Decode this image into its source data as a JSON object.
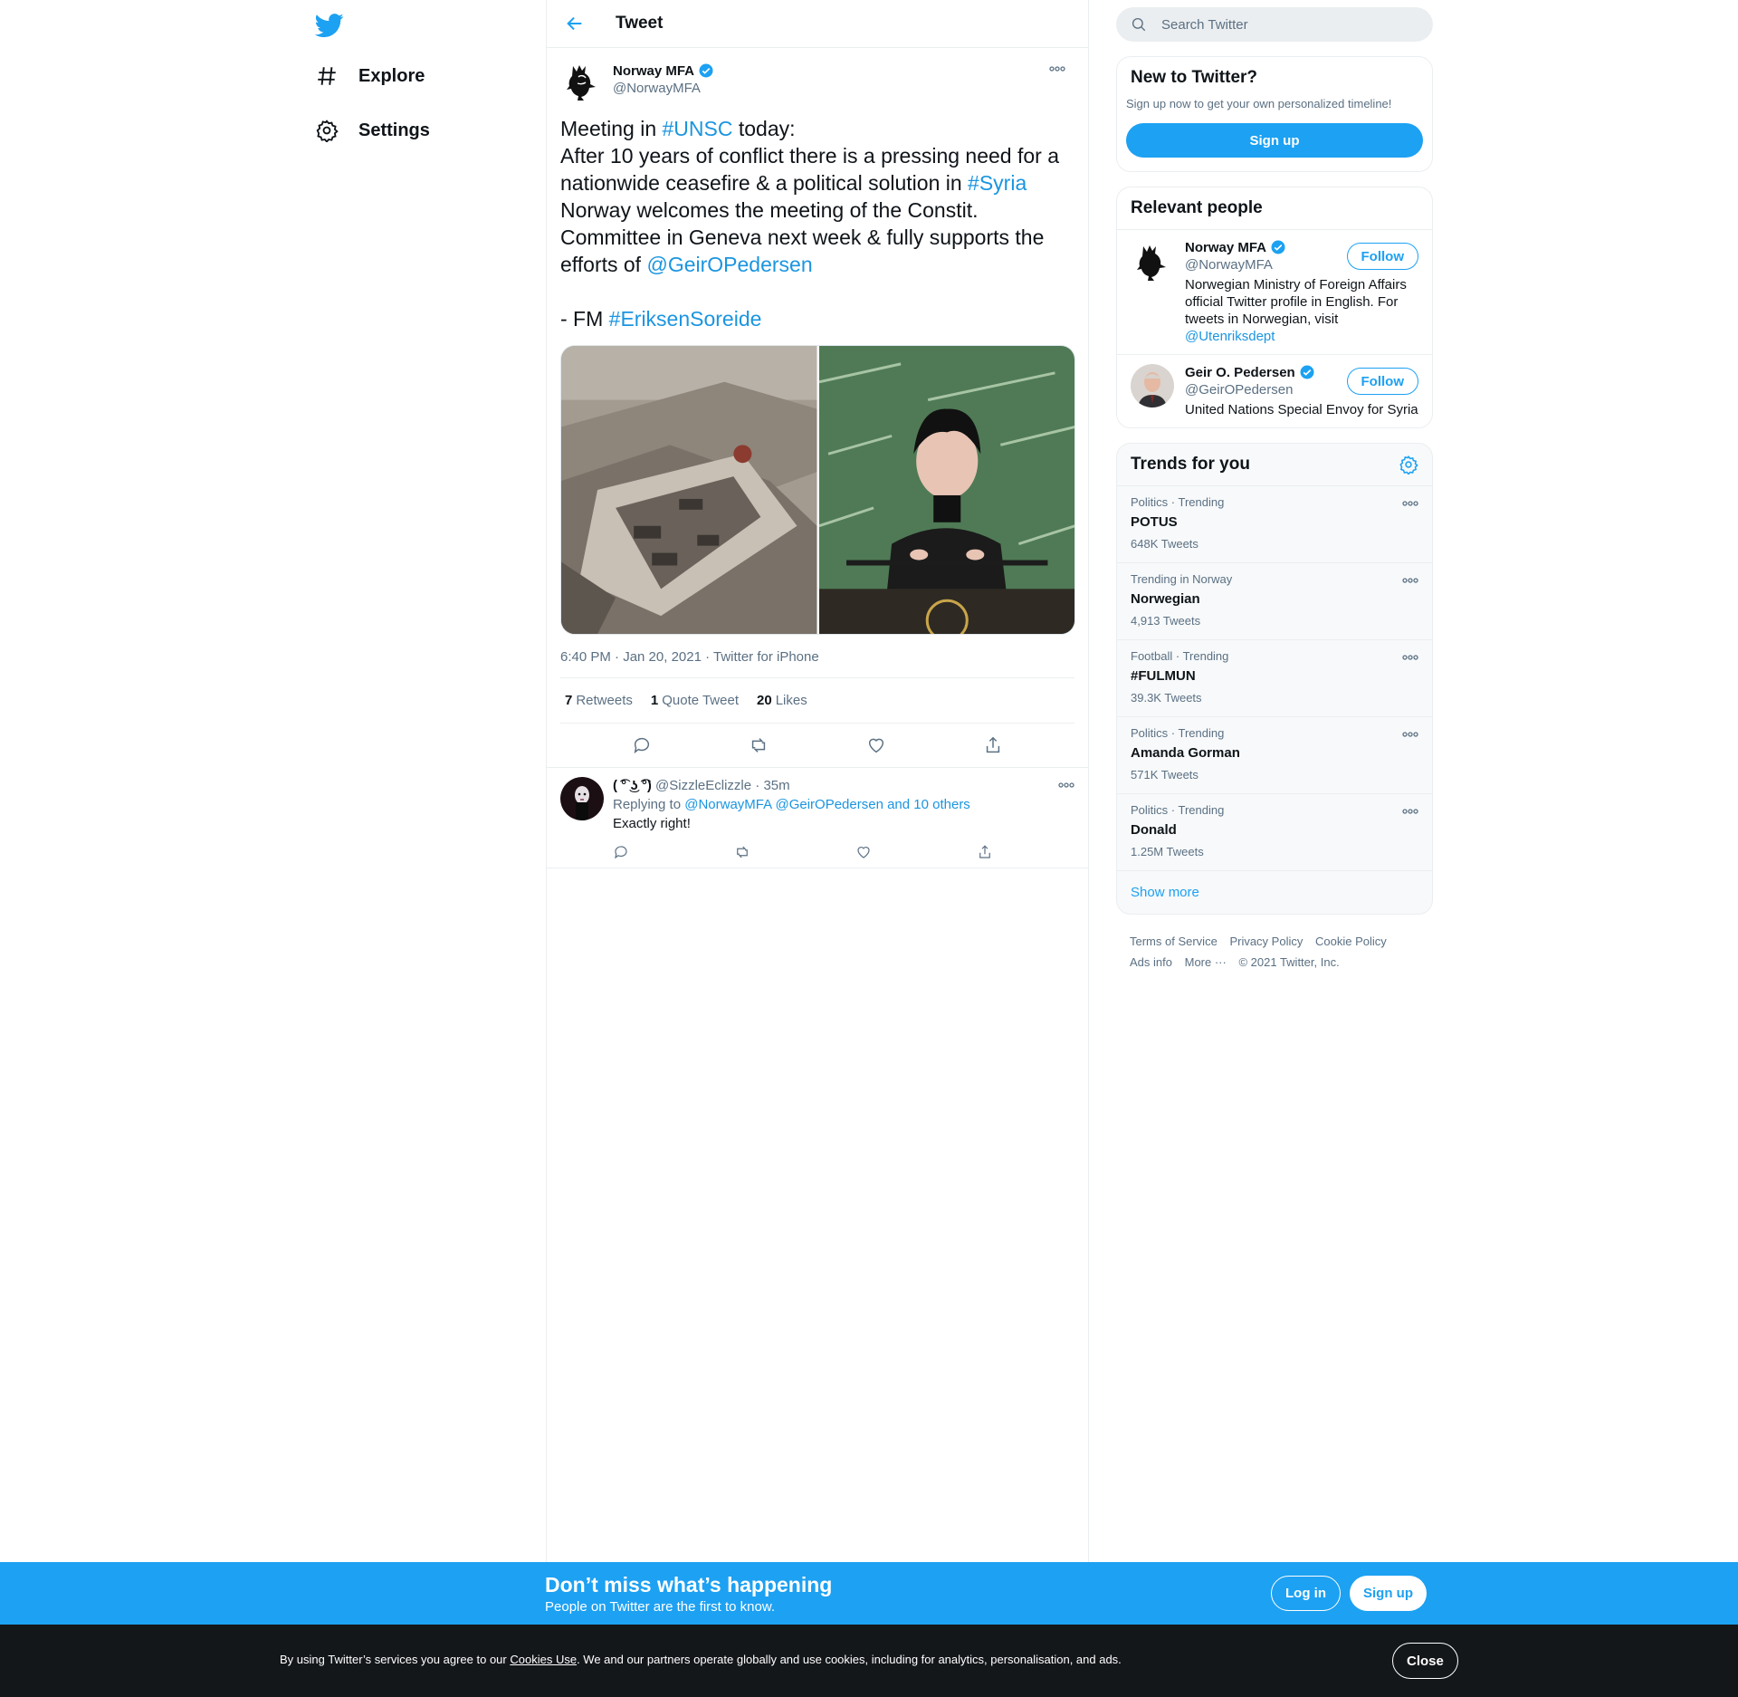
{
  "nav": {
    "items": [
      {
        "label": "Explore",
        "icon": "hashtag-icon"
      },
      {
        "label": "Settings",
        "icon": "gear-icon"
      }
    ]
  },
  "header": {
    "title": "Tweet"
  },
  "tweet": {
    "author_name": "Norway MFA",
    "author_handle": "@NorwayMFA",
    "text_parts": {
      "p1": "Meeting in ",
      "h1": "#UNSC",
      "p2": " today:\nAfter 10 years of conflict there is a pressing need for a nationwide ceasefire & a political solution in ",
      "h2": "#Syria",
      "p3": "\nNorway welcomes the meeting of the Constit. Committee in Geneva next week & fully supports the efforts of ",
      "h3": "@GeirOPedersen",
      "p4": "\n\n- FM ",
      "h4": "#EriksenSoreide"
    },
    "timestamp": "6:40 PM · Jan 20, 2021 · Twitter for iPhone",
    "stats": {
      "retweets_count": "7",
      "retweets_label": "Retweets",
      "quotes_count": "1",
      "quotes_label": "Quote Tweet",
      "likes_count": "20",
      "likes_label": "Likes"
    }
  },
  "reply": {
    "author_name": "( ͡° ͜ʖ ͡°)",
    "author_handle": "@SizzleEclizzle",
    "age": "· 35m",
    "replying_prefix": "Replying to ",
    "replying_to": "@NorwayMFA @GeirOPedersen and 10 others",
    "text": "Exactly right!"
  },
  "search": {
    "placeholder": "Search Twitter"
  },
  "new_card": {
    "title": "New to Twitter?",
    "subtitle": "Sign up now to get your own personalized timeline!",
    "button": "Sign up"
  },
  "people": {
    "title": "Relevant people",
    "follow_label": "Follow",
    "items": [
      {
        "name": "Norway MFA",
        "handle": "@NorwayMFA",
        "bio": "Norwegian Ministry of Foreign Affairs official Twitter profile in English. For tweets in Norwegian, visit ",
        "bio_link": "@Utenriksdept"
      },
      {
        "name": "Geir O. Pedersen",
        "handle": "@GeirOPedersen",
        "bio": "United Nations Special Envoy for Syria",
        "bio_link": ""
      }
    ]
  },
  "trends": {
    "title": "Trends for you",
    "items": [
      {
        "context": "Politics · Trending",
        "name": "POTUS",
        "count": "648K Tweets"
      },
      {
        "context": "Trending in Norway",
        "name": "Norwegian",
        "count": "4,913 Tweets"
      },
      {
        "context": "Football · Trending",
        "name": "#FULMUN",
        "count": "39.3K Tweets"
      },
      {
        "context": "Politics · Trending",
        "name": "Amanda Gorman",
        "count": "571K Tweets"
      },
      {
        "context": "Politics · Trending",
        "name": "Donald",
        "count": "1.25M Tweets"
      }
    ],
    "show_more": "Show more"
  },
  "footer": {
    "terms": "Terms of Service",
    "privacy": "Privacy Policy",
    "cookie": "Cookie Policy",
    "ads": "Ads info",
    "more": "More ···",
    "copyright": "© 2021 Twitter, Inc."
  },
  "banner": {
    "title": "Don’t miss what’s happening",
    "subtitle": "People on Twitter are the first to know.",
    "login": "Log in",
    "signup": "Sign up"
  },
  "cookies": {
    "prefix": "By using Twitter’s services you agree to our ",
    "link": "Cookies Use",
    "suffix": ". We and our partners operate globally and use cookies, including for analytics, personalisation, and ads.",
    "close": "Close"
  },
  "colors": {
    "accent": "#1da1f2",
    "text": "#0f1419",
    "muted": "#5b7083",
    "banner": "#1da1f2",
    "cookie_bar": "#14171a"
  }
}
